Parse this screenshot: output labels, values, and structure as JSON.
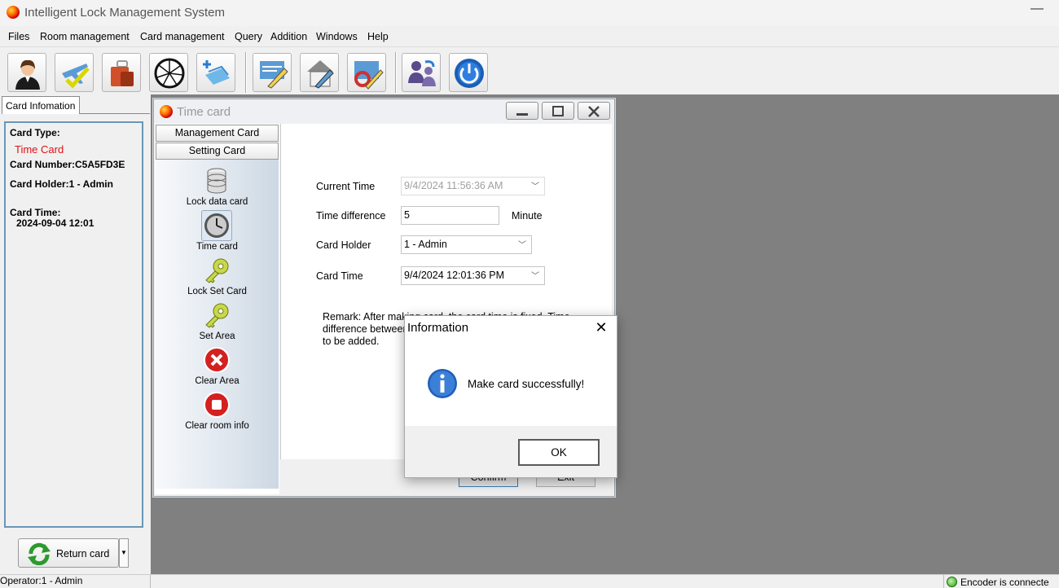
{
  "app": {
    "title": "Intelligent Lock Management System",
    "minimize": "—"
  },
  "menu": [
    "Files",
    "Room management",
    "Card management",
    "Query",
    "Addition",
    "Windows",
    "Help"
  ],
  "toolbar": {
    "buttons": [
      "operator-icon",
      "check-in-icon",
      "luggage-icon",
      "wheel-icon",
      "add-card-icon",
      "edit-icon",
      "room-edit-icon",
      "refresh-edit-icon",
      "switch-user-icon",
      "power-icon"
    ]
  },
  "left_panel": {
    "tab": "Card Infomation",
    "card_type_label": "Card Type:",
    "card_type_value": "Time Card",
    "card_type_color": "#e01010",
    "card_number": "Card Number:C5A5FD3E",
    "card_holder": "Card Holder:1 - Admin",
    "card_time_label": "Card Time:",
    "card_time_value": "2024-09-04 12:01",
    "return_button": "Return card"
  },
  "status": {
    "operator": "Operator:1 - Admin",
    "encoder": "Encoder is connecte"
  },
  "time_card": {
    "title": "Time card",
    "nav_headers": [
      "Management Card",
      "Setting Card"
    ],
    "nav_items": [
      "Lock data card",
      "Time card",
      "Lock Set Card",
      "Set Area",
      "Clear Area",
      "Clear room info"
    ],
    "fields": {
      "current_time_label": "Current Time",
      "current_time_value": "9/4/2024 11:56:36 AM",
      "time_difference_label": "Time difference",
      "time_difference_value": "5",
      "time_difference_unit": "Minute",
      "card_holder_label": "Card Holder",
      "card_holder_value": "1 - Admin",
      "card_time_label": "Card Time",
      "card_time_value": "9/4/2024 12:01:36 PM"
    },
    "remark_lines": [
      "Remark: After making card, the card time is fixed. Time",
      "difference between",
      "to be added."
    ],
    "confirm_button": "Confirm",
    "exit_button": "Exit"
  },
  "dialog": {
    "title": "Information",
    "message": "Make card successfully!",
    "ok_button": "OK",
    "close": "✕"
  }
}
